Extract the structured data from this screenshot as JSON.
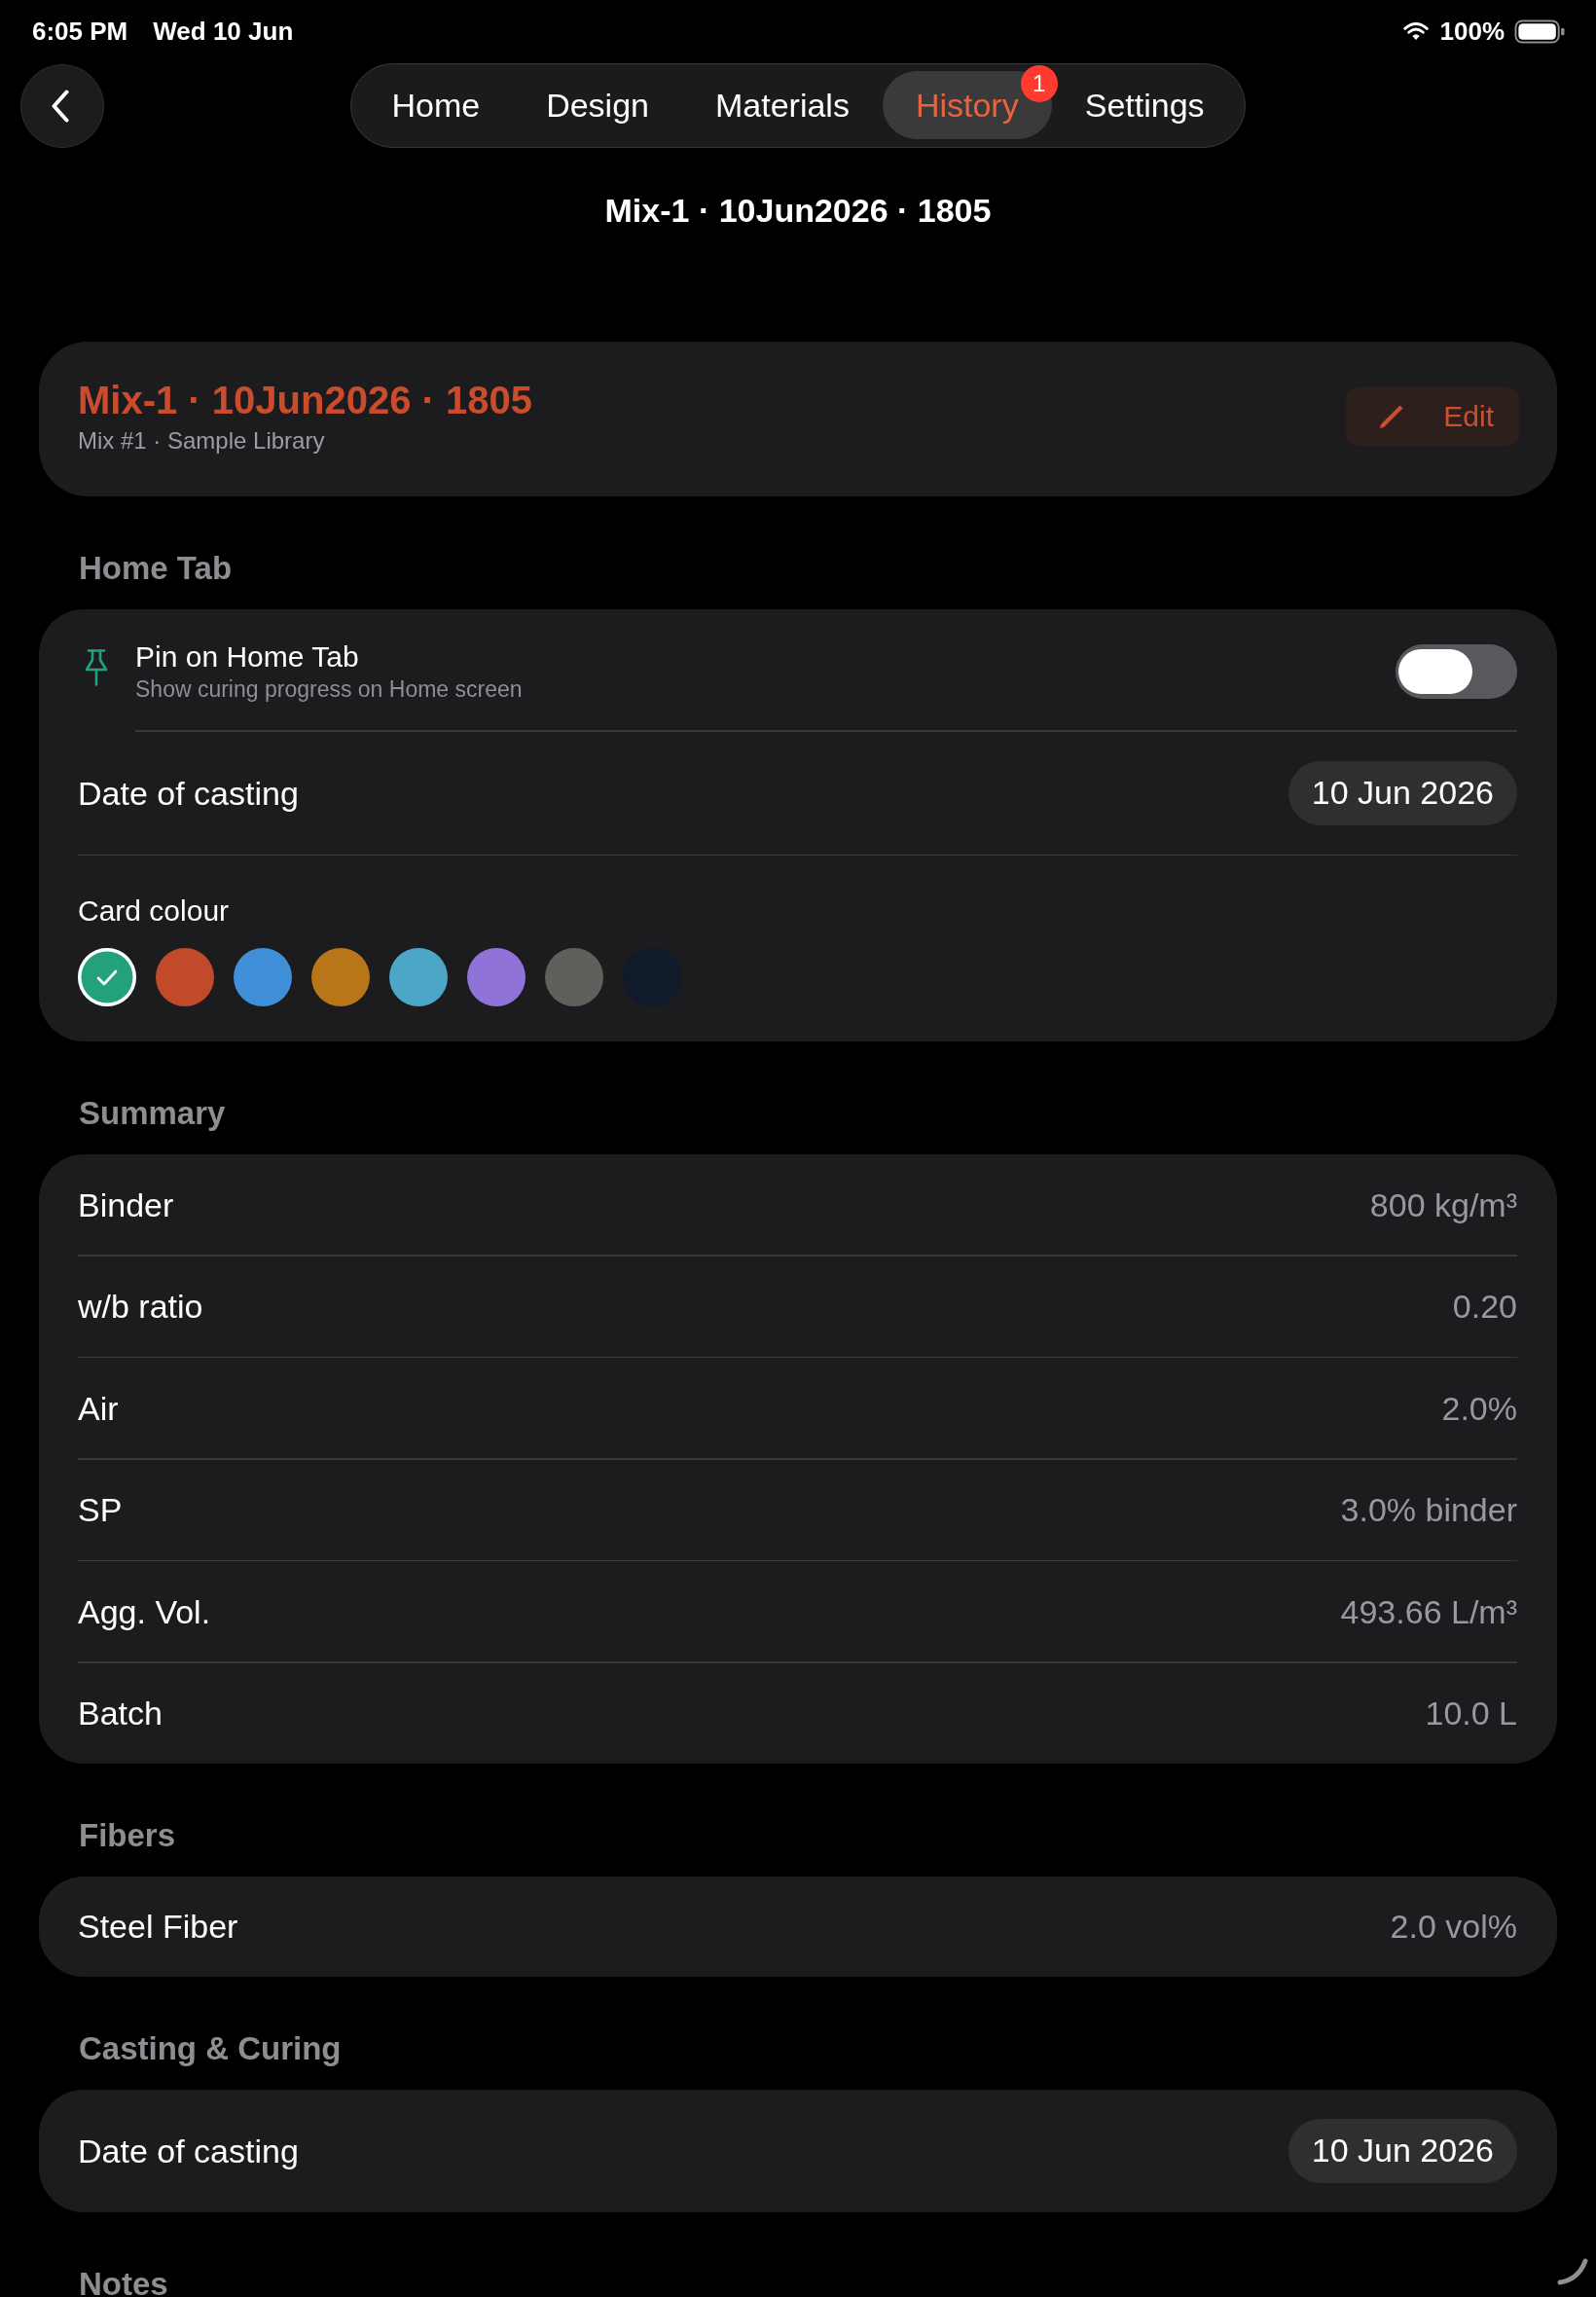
{
  "status_bar": {
    "time": "6:05 PM",
    "date": "Wed 10 Jun",
    "battery": "100%"
  },
  "nav": {
    "tabs": [
      {
        "label": "Home",
        "selected": false
      },
      {
        "label": "Design",
        "selected": false
      },
      {
        "label": "Materials",
        "selected": false
      },
      {
        "label": "History",
        "selected": true,
        "badge": "1"
      },
      {
        "label": "Settings",
        "selected": false
      }
    ]
  },
  "page_title": "Mix-1 · 10Jun2026 · 1805",
  "header_card": {
    "title": "Mix-1 · 10Jun2026 · 1805",
    "subtitle": "Mix #1 · Sample Library",
    "edit_button": "Edit"
  },
  "sections": [
    {
      "heading": "Home Tab",
      "rows": [
        {
          "kind": "toggle",
          "title": "Pin on Home Tab",
          "subtitle": "Show curing progress on Home screen",
          "on": false
        },
        {
          "kind": "date",
          "label": "Date of casting",
          "value": "10 Jun 2026"
        },
        {
          "kind": "colours",
          "label": "Card colour",
          "swatches": [
            {
              "color": "#23a17b",
              "selected": true
            },
            {
              "color": "#c24a2b",
              "selected": false
            },
            {
              "color": "#3f8fd9",
              "selected": false
            },
            {
              "color": "#b87618",
              "selected": false
            },
            {
              "color": "#4ba6c8",
              "selected": false
            },
            {
              "color": "#9073d8",
              "selected": false
            },
            {
              "color": "#5f5f5b",
              "selected": false
            },
            {
              "color": "#0f1a2a",
              "selected": false
            }
          ]
        }
      ]
    },
    {
      "heading": "Summary",
      "rows": [
        {
          "kind": "value",
          "label": "Binder",
          "value": "800 kg/m³"
        },
        {
          "kind": "value",
          "label": "w/b ratio",
          "value": "0.20"
        },
        {
          "kind": "value",
          "label": "Air",
          "value": "2.0%"
        },
        {
          "kind": "value",
          "label": "SP",
          "value": "3.0% binder"
        },
        {
          "kind": "value",
          "label": "Agg. Vol.",
          "value": "493.66 L/m³"
        },
        {
          "kind": "value",
          "label": "Batch",
          "value": "10.0 L"
        }
      ]
    },
    {
      "heading": "Fibers",
      "rows": [
        {
          "kind": "value",
          "label": "Steel Fiber",
          "value": "2.0 vol%"
        }
      ]
    },
    {
      "heading": "Casting & Curing",
      "rows": [
        {
          "kind": "date",
          "label": "Date of casting",
          "value": "10 Jun 2026"
        }
      ]
    },
    {
      "heading": "Notes"
    }
  ]
}
